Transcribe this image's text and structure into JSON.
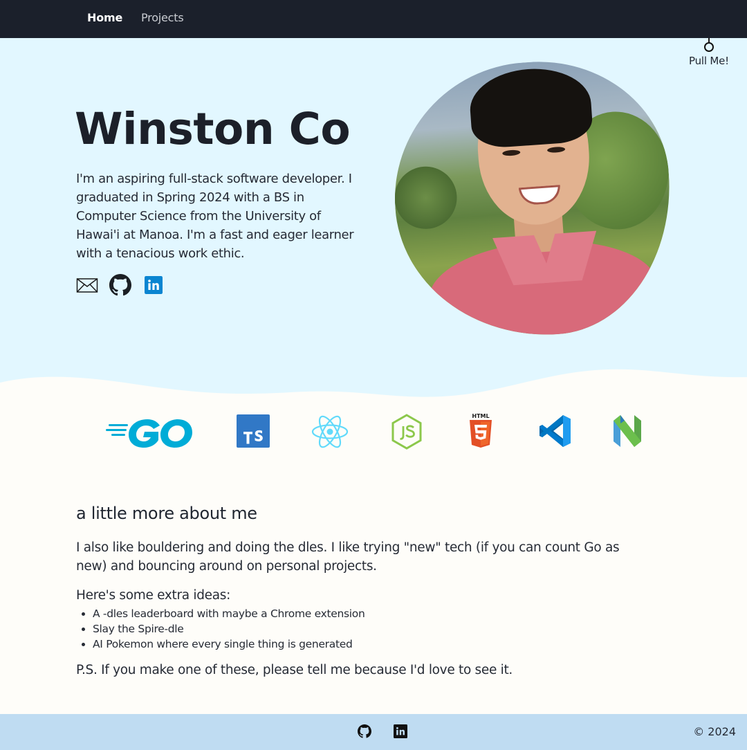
{
  "nav": {
    "home": "Home",
    "projects": "Projects"
  },
  "pull": {
    "label": "Pull Me!"
  },
  "hero": {
    "name": "Winston Co",
    "bio": "I'm an aspiring full-stack software developer. I graduated in Spring 2024 with a BS in Computer Science from the University of Hawai'i at Manoa. I'm a fast and eager learner with a tenacious work ethic.",
    "colors": {
      "background": "#e2f7ff",
      "text": "#1c2029"
    }
  },
  "icons": {
    "social": [
      "mail-icon",
      "github-icon",
      "linkedin-icon"
    ],
    "tech": [
      "go-icon",
      "typescript-icon",
      "react-icon",
      "nodejs-icon",
      "html5-icon",
      "vscode-icon",
      "neovim-icon"
    ]
  },
  "about": {
    "title": "a little more about me",
    "paragraph": "I also like bouldering and doing the dles. I like trying \"new\" tech (if you can count Go as new) and bouncing around on personal projects.",
    "ideas_title": "Here's some extra ideas:",
    "ideas": [
      "A -dles leaderboard with maybe a Chrome extension",
      "Slay the Spire-dle",
      "AI Pokemon where every single thing is generated"
    ],
    "ps": "P.S. If you make one of these, please tell me because I'd love to see it."
  },
  "footer": {
    "copyright": "© 2024",
    "background": "#bfdcf2"
  }
}
